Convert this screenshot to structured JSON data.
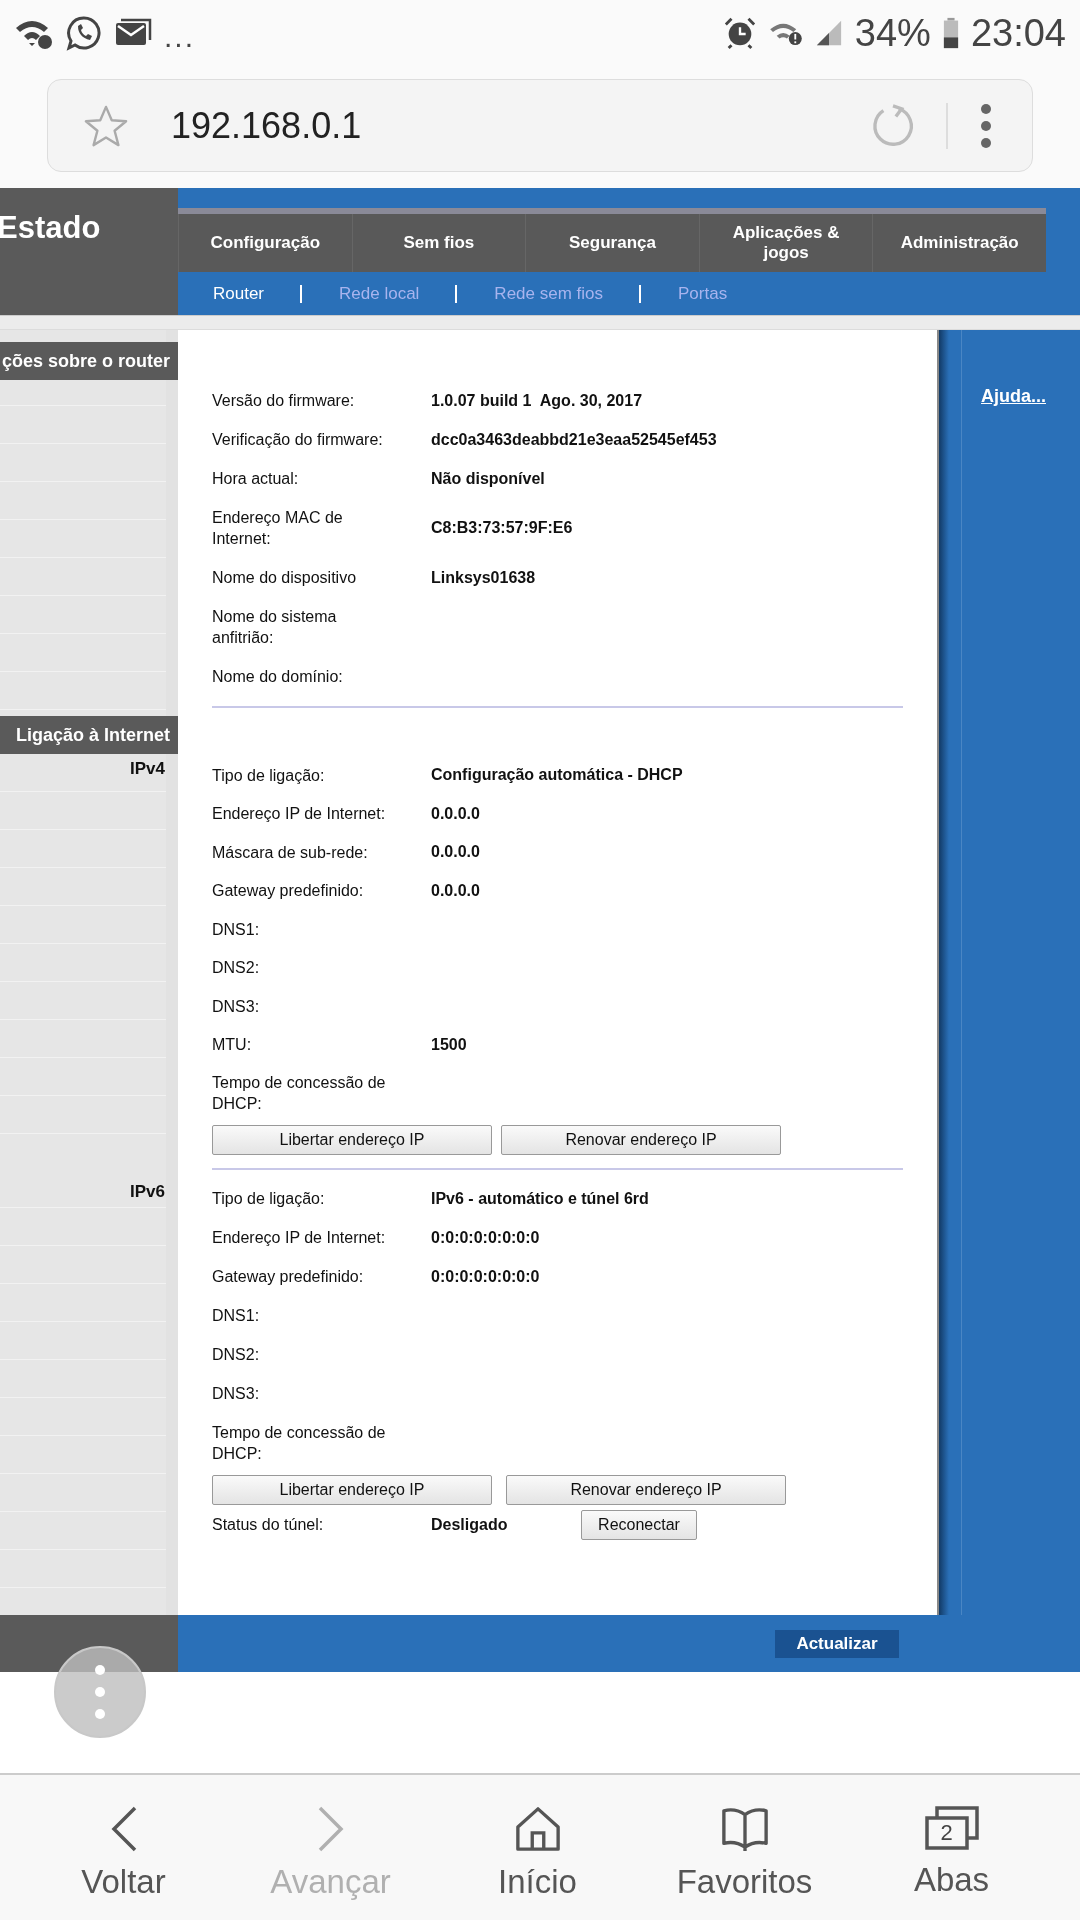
{
  "status_bar": {
    "overflow": "...",
    "battery": "34%",
    "time": "23:04"
  },
  "address_bar": {
    "url": "192.168.0.1"
  },
  "router_page": {
    "section_title": "Estado",
    "main_tabs": [
      {
        "label": "Configuração"
      },
      {
        "label": "Sem fios"
      },
      {
        "label": "Segurança"
      },
      {
        "label": "Aplicações & jogos"
      },
      {
        "label": "Administração"
      }
    ],
    "sub_tabs": [
      {
        "label": "Router",
        "selected": true
      },
      {
        "label": "Rede local",
        "selected": false
      },
      {
        "label": "Rede sem fios",
        "selected": false
      },
      {
        "label": "Portas",
        "selected": false
      }
    ],
    "help_link": "Ajuda...",
    "blocks": [
      {
        "sidebar_title": "ções sobre o router",
        "rows": [
          {
            "label": "Versão do firmware:",
            "value": "1.0.07 build 1  Ago. 30, 2017"
          },
          {
            "label": "Verificação do firmware:",
            "value": "dcc0a3463deabbd21e3eaa52545ef453"
          },
          {
            "label": "Hora actual:",
            "value": "Não disponível"
          },
          {
            "label": "Endereço MAC de Internet:",
            "value": "C8:B3:73:57:9F:E6"
          },
          {
            "label": "Nome do dispositivo",
            "value": "Linksys01638"
          },
          {
            "label": "Nome do sistema anfitrião:"
          },
          {
            "label": "Nome do domínio:"
          }
        ]
      },
      {
        "sidebar_title": "Ligação à Internet",
        "sidebar_label": "IPv4",
        "rows": [
          {
            "label": "Tipo de ligação:",
            "value": "Configuração automática - DHCP"
          },
          {
            "label": "Endereço IP de Internet:",
            "value": "0.0.0.0"
          },
          {
            "label": "Máscara de sub-rede:",
            "value": "0.0.0.0"
          },
          {
            "label": "Gateway predefinido:",
            "value": "0.0.0.0"
          },
          {
            "label": "DNS1:"
          },
          {
            "label": "DNS2:"
          },
          {
            "label": "DNS3:"
          },
          {
            "label": "MTU:",
            "value": "1500"
          },
          {
            "label": "Tempo de concessão de DHCP:"
          }
        ],
        "buttons": [
          "Libertar endereço IP",
          "Renovar endereço IP"
        ]
      },
      {
        "sidebar_label": "IPv6",
        "rows": [
          {
            "label": "Tipo de ligação:",
            "value": "IPv6 - automático e túnel 6rd"
          },
          {
            "label": "Endereço IP de Internet:",
            "value": "0:0:0:0:0:0:0:0"
          },
          {
            "label": "Gateway predefinido:",
            "value": "0:0:0:0:0:0:0:0"
          },
          {
            "label": "DNS1:"
          },
          {
            "label": "DNS2:"
          },
          {
            "label": "DNS3:"
          },
          {
            "label": "Tempo de concessão de DHCP:"
          }
        ],
        "buttons": [
          "Libertar endereço IP",
          "Renovar endereço IP"
        ],
        "tunnel_status": {
          "label": "Status do túnel:",
          "value": "Desligado",
          "button": "Reconectar"
        }
      }
    ],
    "update_button": "Actualizar"
  },
  "bottom_nav": [
    {
      "kind": "back",
      "label": "Voltar",
      "disabled": false
    },
    {
      "kind": "forward",
      "label": "Avançar",
      "disabled": true
    },
    {
      "kind": "home",
      "label": "Início",
      "disabled": false
    },
    {
      "kind": "bookmarks",
      "label": "Favoritos",
      "disabled": false
    },
    {
      "kind": "tabs",
      "label": "Abas",
      "disabled": false,
      "count": "2"
    }
  ]
}
